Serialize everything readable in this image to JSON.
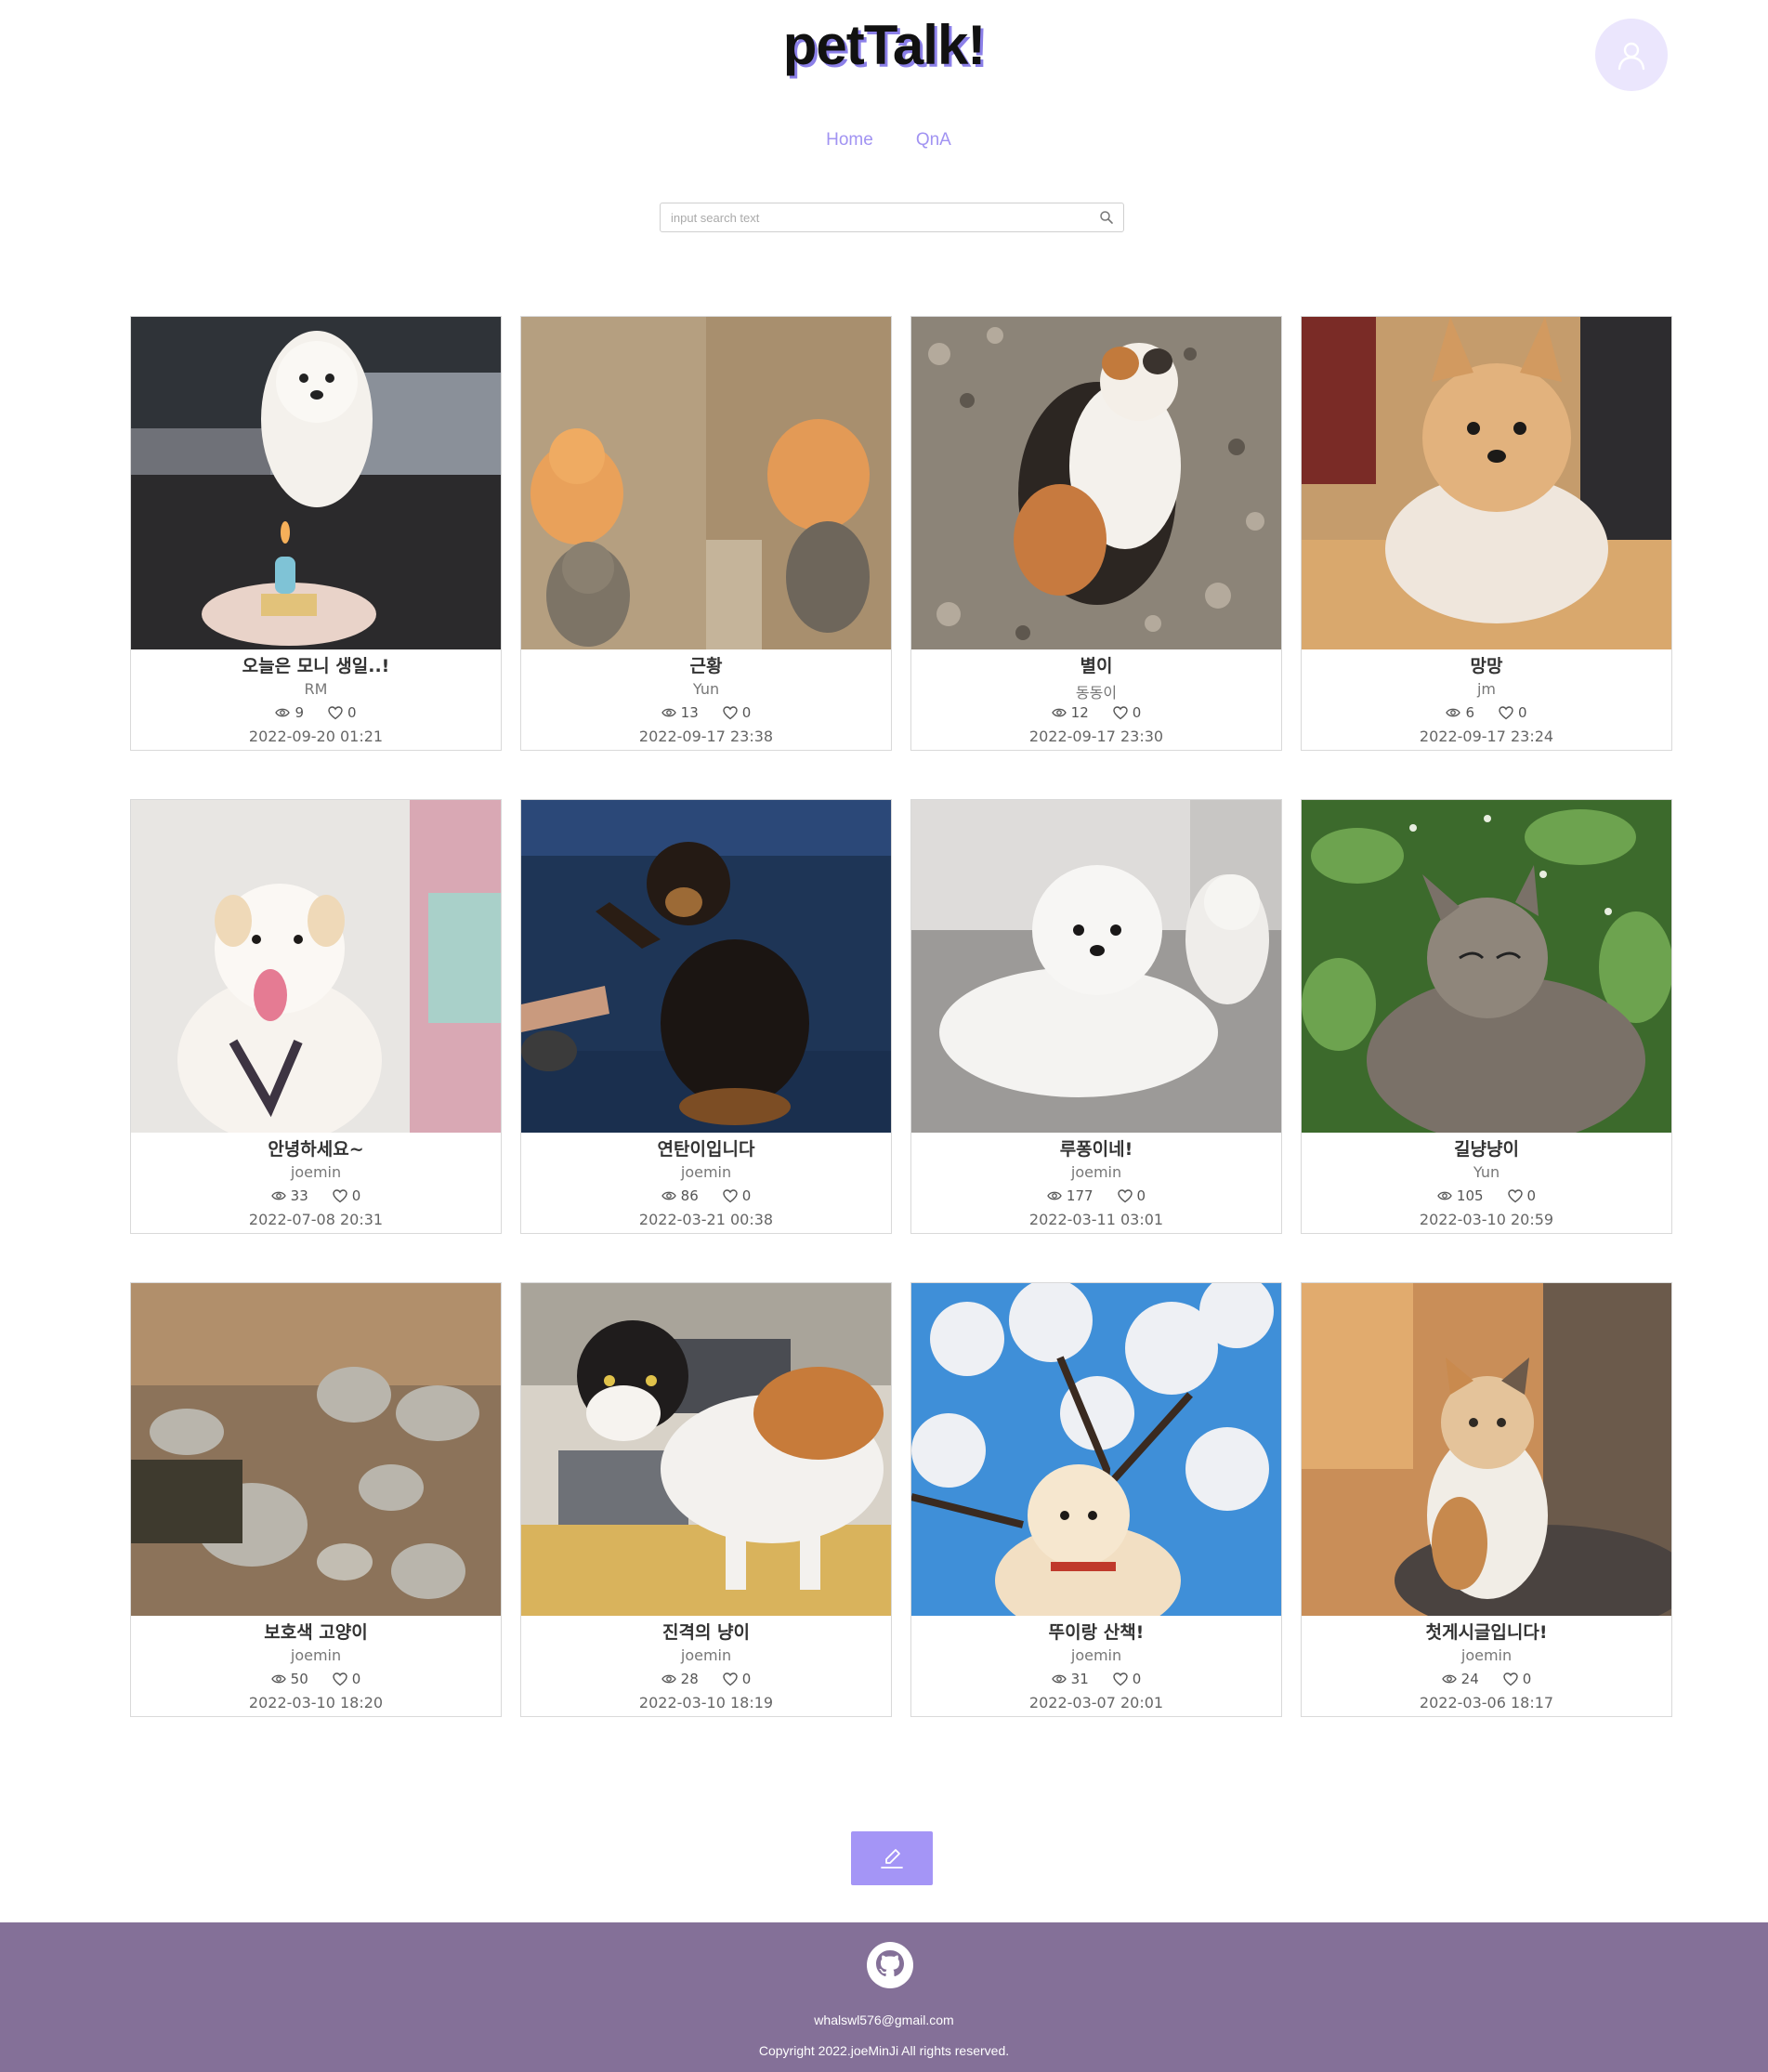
{
  "header": {
    "logo": "petTalk!",
    "nav": [
      {
        "label": "Home"
      },
      {
        "label": "QnA"
      }
    ],
    "avatar_icon": "user-icon"
  },
  "search": {
    "placeholder": "input search text",
    "icon": "search-icon"
  },
  "posts": [
    {
      "title": "오늘은 모니 생일..!",
      "author": "RM",
      "views": "9",
      "likes": "0",
      "date": "2022-09-20 01:21"
    },
    {
      "title": "근황",
      "author": "Yun",
      "views": "13",
      "likes": "0",
      "date": "2022-09-17 23:38"
    },
    {
      "title": "별이",
      "author": "동동이",
      "views": "12",
      "likes": "0",
      "date": "2022-09-17 23:30"
    },
    {
      "title": "망망",
      "author": "jm",
      "views": "6",
      "likes": "0",
      "date": "2022-09-17 23:24"
    },
    {
      "title": "안녕하세요~",
      "author": "joemin",
      "views": "33",
      "likes": "0",
      "date": "2022-07-08 20:31"
    },
    {
      "title": "연탄이입니다",
      "author": "joemin",
      "views": "86",
      "likes": "0",
      "date": "2022-03-21 00:38"
    },
    {
      "title": "루퐁이네!",
      "author": "joemin",
      "views": "177",
      "likes": "0",
      "date": "2022-03-11 03:01"
    },
    {
      "title": "길냥냥이",
      "author": "Yun",
      "views": "105",
      "likes": "0",
      "date": "2022-03-10 20:59"
    },
    {
      "title": "보호색 고양이",
      "author": "joemin",
      "views": "50",
      "likes": "0",
      "date": "2022-03-10 18:20"
    },
    {
      "title": "진격의 냥이",
      "author": "joemin",
      "views": "28",
      "likes": "0",
      "date": "2022-03-10 18:19"
    },
    {
      "title": "뚜이랑 산책!",
      "author": "joemin",
      "views": "31",
      "likes": "0",
      "date": "2022-03-07 20:01"
    },
    {
      "title": "첫게시글입니다!",
      "author": "joemin",
      "views": "24",
      "likes": "0",
      "date": "2022-03-06 18:17"
    }
  ],
  "write_button": {
    "icon": "edit-icon"
  },
  "footer": {
    "icon": "github-icon",
    "email": "whalswl576@gmail.com",
    "copyright": "Copyright 2022.joeMinJi All rights reserved."
  },
  "colors": {
    "accent": "#a495f6",
    "nav_text": "#a193f2",
    "footer_bg": "#847098",
    "avatar_bg": "#ebe6fd"
  }
}
